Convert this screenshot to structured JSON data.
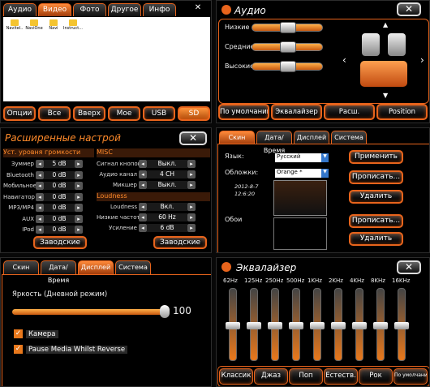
{
  "files": {
    "tabs": [
      "Аудио",
      "Видео",
      "Фото",
      "Другое",
      "Инфо"
    ],
    "close": "✕",
    "folders": [
      "Navitel..",
      "NaviOne",
      "Navi",
      "Instruct..."
    ],
    "buttons": [
      "Опции",
      "Все",
      "Вверх",
      "Мое",
      "USB",
      "SD"
    ]
  },
  "audio": {
    "title": "Аудио",
    "close": "✕",
    "sliders": [
      {
        "label": "Низкие",
        "level": 0.5
      },
      {
        "label": "Средние",
        "level": 0.5
      },
      {
        "label": "Высокие",
        "level": 0.5
      }
    ],
    "buttons": [
      "По умолчанию",
      "Эквалайзер",
      "Расш.",
      "Position"
    ]
  },
  "adv": {
    "title": "Расширенные настрой",
    "close": "✕",
    "left_header": "Уст. уровня  громкости",
    "left_rows": [
      {
        "label": "Зуммер",
        "value": "5 dB"
      },
      {
        "label": "Bluetooth",
        "value": "0 dB"
      },
      {
        "label": "Мобильное медиа",
        "value": "0 dB"
      },
      {
        "label": "Навигатор",
        "value": "0 dB"
      },
      {
        "label": "MP3/MP4",
        "value": "0 dB"
      },
      {
        "label": "AUX",
        "value": "0 dB"
      },
      {
        "label": "IPod",
        "value": "0 dB"
      }
    ],
    "misc_header": "MISC",
    "misc_rows": [
      {
        "label": "Сигнал кнопок",
        "value": "Выкл."
      },
      {
        "label": "Аудио канал",
        "value": "4 CH"
      },
      {
        "label": "Микшер",
        "value": "Выкл."
      }
    ],
    "loud_header": "Loudness",
    "loud_rows": [
      {
        "label": "Loudness",
        "value": "Вкл."
      },
      {
        "label": "Низкие частоты",
        "value": "60 Hz"
      },
      {
        "label": "Усиление",
        "value": "6 dB"
      }
    ],
    "factory": "Заводские"
  },
  "skin": {
    "tabs": [
      "Скин",
      "Дата/Время",
      "Дисплей",
      "Система"
    ],
    "lang_label": "Язык:",
    "lang_value": "Русский",
    "skin_label": "Обложки:",
    "skin_value": "Orange *",
    "date": "2012-8-7",
    "time": "12:6:20",
    "wall_label": "Обои",
    "buttons": [
      "Применить",
      "Прописать...",
      "Удалить",
      "Прописать...",
      "Удалить"
    ]
  },
  "disp": {
    "tabs": [
      "Скин",
      "Дата/Время",
      "Дисплей",
      "Система"
    ],
    "bright_label": "Яркость (Дневной режим)",
    "bright_value": "100",
    "bright_level": 1.0,
    "checks": [
      "Камера",
      "Pause Media Whilst Reverse"
    ]
  },
  "eq": {
    "title": "Эквалайзер",
    "close": "✕",
    "bands": [
      "62Hz",
      "125Hz",
      "250Hz",
      "500Hz",
      "1KHz",
      "2KHz",
      "4KHz",
      "8KHz",
      "16KHz"
    ],
    "levels": [
      0.5,
      0.5,
      0.5,
      0.5,
      0.5,
      0.5,
      0.5,
      0.5,
      0.5
    ],
    "presets": [
      "Классик",
      "Джаз",
      "Поп",
      "Естеств.",
      "Рок",
      "По умолчанию"
    ]
  }
}
